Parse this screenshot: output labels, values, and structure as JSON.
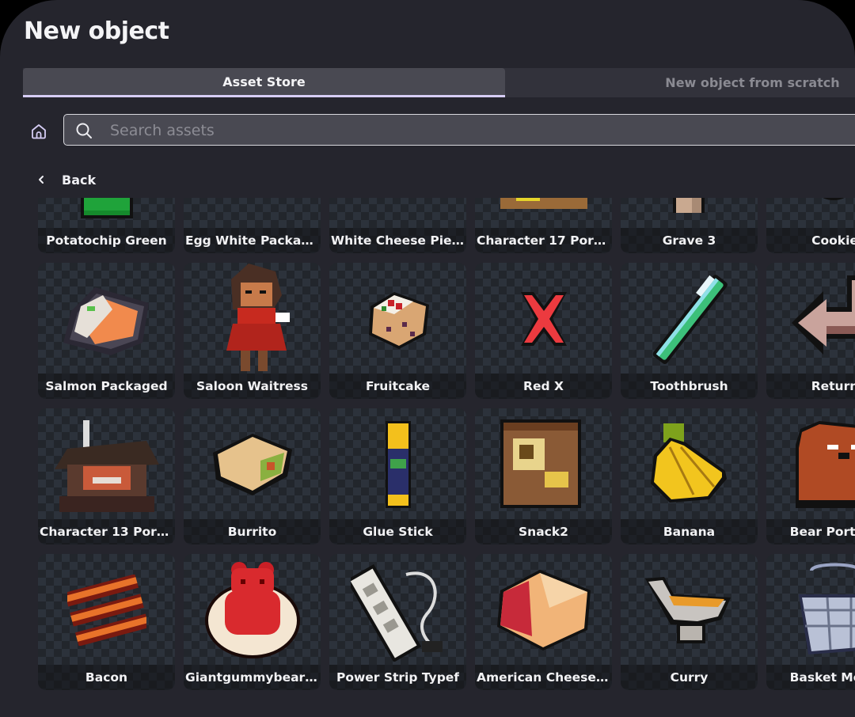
{
  "dialog": {
    "title": "New object",
    "tabs": [
      {
        "label": "Asset Store",
        "active": true
      },
      {
        "label": "New object from scratch",
        "active": false
      }
    ],
    "search": {
      "placeholder": "Search assets",
      "value": ""
    },
    "back_label": "Back",
    "accent_color": "#d6cdf5"
  },
  "assets": [
    {
      "name": "Potatochip Green",
      "icon": "potato-chip-bag-green"
    },
    {
      "name": "Egg White Packaged",
      "icon": "egg-carton"
    },
    {
      "name": "White Cheese Piec...",
      "icon": "cheese-wedge"
    },
    {
      "name": "Character 17 Portr...",
      "icon": "cowboy-portrait"
    },
    {
      "name": "Grave 3",
      "icon": "grave-cross"
    },
    {
      "name": "Cookie",
      "icon": "cookie"
    },
    {
      "name": "Salmon Packaged",
      "icon": "salmon-package"
    },
    {
      "name": "Saloon Waitress",
      "icon": "waitress-character"
    },
    {
      "name": "Fruitcake",
      "icon": "fruitcake"
    },
    {
      "name": "Red X",
      "icon": "red-x"
    },
    {
      "name": "Toothbrush",
      "icon": "toothbrush"
    },
    {
      "name": "Return",
      "icon": "return-arrow"
    },
    {
      "name": "Character 13 Portr...",
      "icon": "character-portrait-hat"
    },
    {
      "name": "Burrito",
      "icon": "burrito"
    },
    {
      "name": "Glue Stick",
      "icon": "glue-stick"
    },
    {
      "name": "Snack2",
      "icon": "snack-bag"
    },
    {
      "name": "Banana",
      "icon": "banana-bunch"
    },
    {
      "name": "Bear Portrait",
      "icon": "bear-portrait"
    },
    {
      "name": "Bacon",
      "icon": "bacon"
    },
    {
      "name": "Giantgummybear ...",
      "icon": "gummy-bear-plate"
    },
    {
      "name": "Power Strip Typef",
      "icon": "power-strip"
    },
    {
      "name": "American Cheese ...",
      "icon": "american-cheese"
    },
    {
      "name": "Curry",
      "icon": "curry-gravy-boat"
    },
    {
      "name": "Basket Metal",
      "icon": "metal-basket"
    }
  ]
}
